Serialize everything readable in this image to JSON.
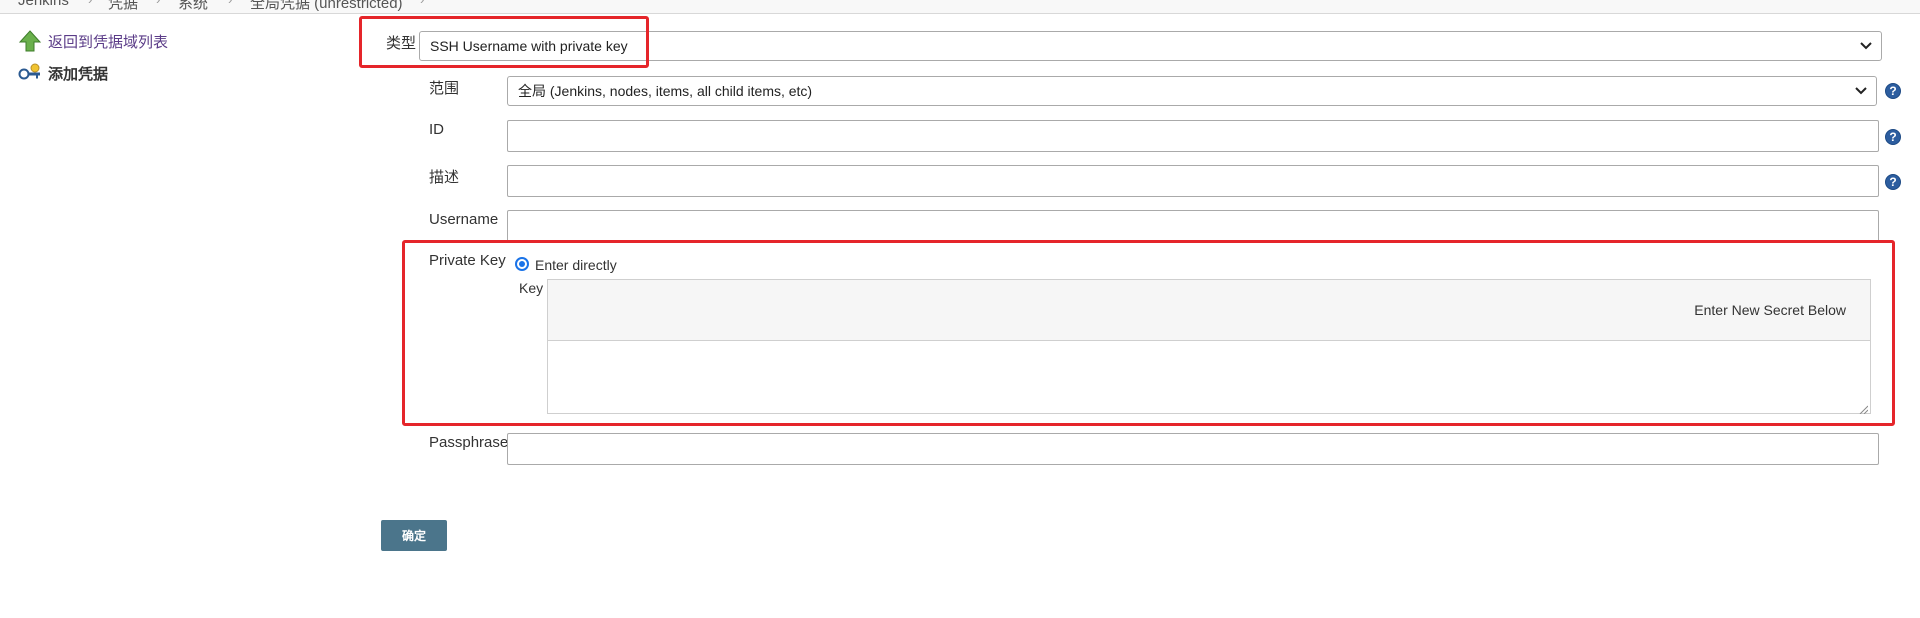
{
  "breadcrumb": [
    "Jenkins",
    "凭据",
    "系统",
    "全局凭据 (unrestricted)"
  ],
  "sidebar": {
    "back_label": "返回到凭据域列表",
    "add_label": "添加凭据"
  },
  "form": {
    "kind_label": "类型",
    "kind_value": "SSH Username with private key",
    "scope_label": "范围",
    "scope_value": "全局 (Jenkins, nodes, items, all child items, etc)",
    "id_label": "ID",
    "id_value": "",
    "description_label": "描述",
    "description_value": "",
    "username_label": "Username",
    "username_value": "",
    "private_key_label": "Private Key",
    "enter_directly_label": "Enter directly",
    "key_label": "Key",
    "secret_notice": "Enter New Secret Below",
    "passphrase_label": "Passphrase",
    "passphrase_value": "",
    "help_glyph": "?"
  },
  "submit_label": "确定",
  "icons": {
    "back": "arrow-up-icon",
    "add": "key-icon",
    "help": "help-icon"
  },
  "colors": {
    "highlight_border": "#e5252a",
    "button_bg": "#4b758b",
    "link": "#5b3c88",
    "help_bg": "#2c5d9f",
    "radio": "#1a73e8"
  }
}
